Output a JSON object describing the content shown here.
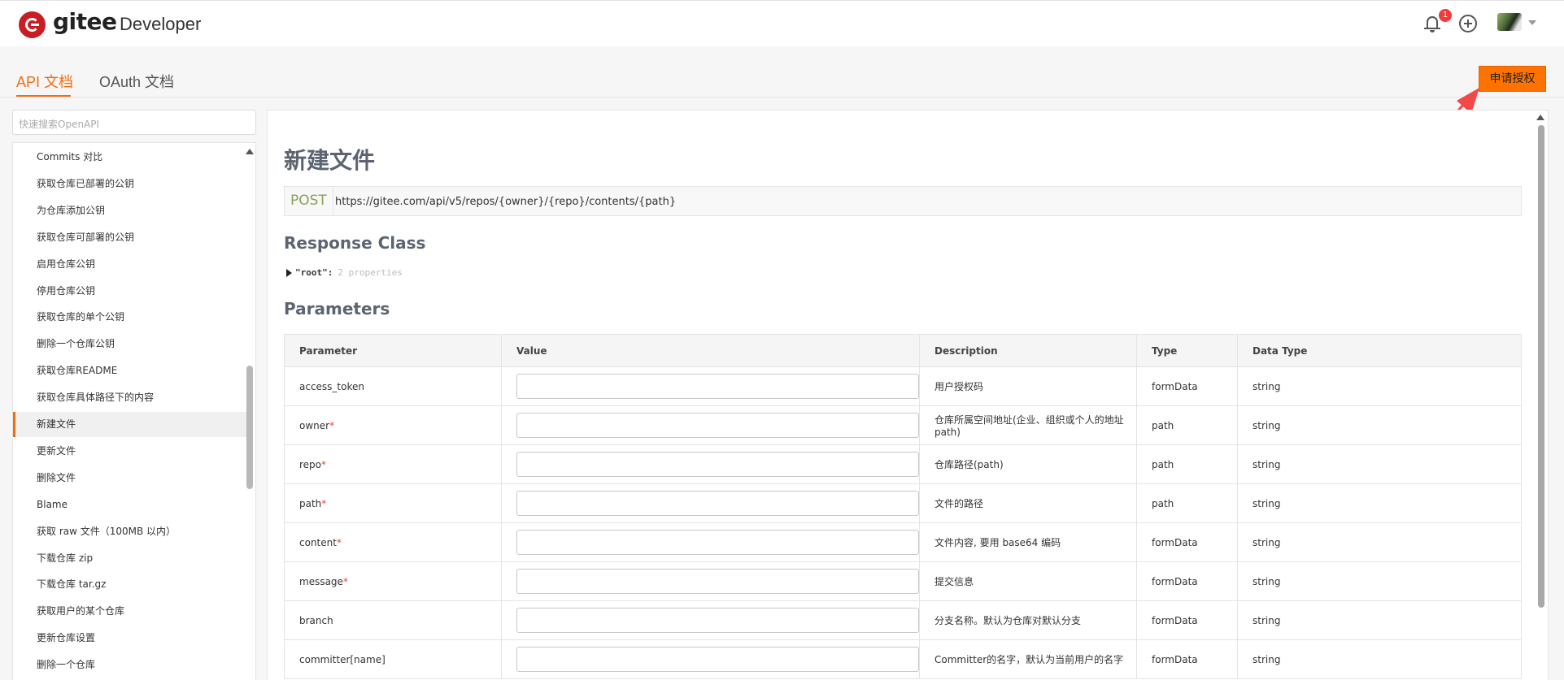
{
  "header": {
    "logo_text": "gitee",
    "section_text": "Developer",
    "notification_count": "1"
  },
  "tabs": [
    {
      "label": "API 文档",
      "active": true
    },
    {
      "label": "OAuth 文档",
      "active": false
    }
  ],
  "actions": {
    "authorize_label": "申请授权"
  },
  "sidebar": {
    "search_placeholder": "快速搜索OpenAPI",
    "items": [
      "Commits 对比",
      "获取仓库已部署的公钥",
      "为仓库添加公钥",
      "获取仓库可部署的公钥",
      "启用仓库公钥",
      "停用仓库公钥",
      "获取仓库的单个公钥",
      "删除一个仓库公钥",
      "获取仓库README",
      "获取仓库具体路径下的内容",
      "新建文件",
      "更新文件",
      "删除文件",
      "Blame",
      "获取 raw 文件（100MB 以内）",
      "下载仓库 zip",
      "下载仓库 tar.gz",
      "获取用户的某个仓库",
      "更新仓库设置",
      "删除一个仓库"
    ],
    "active_item": "新建文件"
  },
  "main": {
    "title": "新建文件",
    "method": "POST",
    "url": "https://gitee.com/api/v5/repos/{owner}/{repo}/contents/{path}",
    "response_heading": "Response Class",
    "root_key": "\"root\":",
    "root_props": "2 properties",
    "params_heading": "Parameters",
    "columns": [
      "Parameter",
      "Value",
      "Description",
      "Type",
      "Data Type"
    ],
    "rows": [
      {
        "name": "access_token",
        "required": false,
        "desc": "用户授权码",
        "type": "formData",
        "dtype": "string"
      },
      {
        "name": "owner",
        "required": true,
        "desc": "仓库所属空间地址(企业、组织或个人的地址path)",
        "type": "path",
        "dtype": "string"
      },
      {
        "name": "repo",
        "required": true,
        "desc": "仓库路径(path)",
        "type": "path",
        "dtype": "string"
      },
      {
        "name": "path",
        "required": true,
        "desc": "文件的路径",
        "type": "path",
        "dtype": "string"
      },
      {
        "name": "content",
        "required": true,
        "desc": "文件内容, 要用 base64 编码",
        "type": "formData",
        "dtype": "string"
      },
      {
        "name": "message",
        "required": true,
        "desc": "提交信息",
        "type": "formData",
        "dtype": "string"
      },
      {
        "name": "branch",
        "required": false,
        "desc": "分支名称。默认为仓库对默认分支",
        "type": "formData",
        "dtype": "string"
      },
      {
        "name": "committer[name]",
        "required": false,
        "desc": "Committer的名字，默认为当前用户的名字",
        "type": "formData",
        "dtype": "string"
      }
    ]
  },
  "colors": {
    "accent": "#fe7300",
    "brand": "#c71d23",
    "annotation_arrow": "#f2484a"
  }
}
